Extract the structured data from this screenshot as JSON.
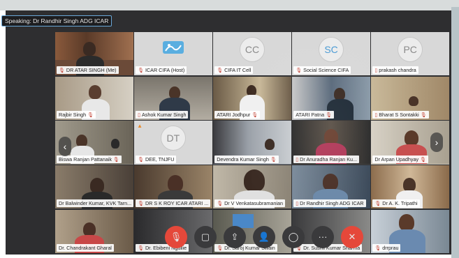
{
  "speaking": {
    "label": "Speaking: Dr Randhir Singh ADG ICAR"
  },
  "tiles": [
    {
      "name": "DR ATAR SINGH (Me)",
      "muted": true
    },
    {
      "name": "ICAR CIFA (Host)",
      "muted": true
    },
    {
      "name": "CIFA IT Cell",
      "muted": true,
      "avatar": "CC"
    },
    {
      "name": "Social Science CIFA",
      "muted": true,
      "avatar": "SC"
    },
    {
      "name": "prakash chandra",
      "muted": false,
      "avatar": "PC"
    },
    {
      "name": "Rajbir Singh",
      "muted": true
    },
    {
      "name": "Ashok Kumar Singh",
      "muted": false
    },
    {
      "name": "ATARI Jodhpur",
      "muted": true
    },
    {
      "name": "ATARI Patna",
      "muted": true
    },
    {
      "name": "Bharat S Sontakki",
      "muted": true
    },
    {
      "name": "Biswa Ranjan Pattanaik",
      "muted": true
    },
    {
      "name": "DEE, TNJFU",
      "muted": true,
      "avatar": "DT"
    },
    {
      "name": "Devendra Kumar Singh",
      "muted": true
    },
    {
      "name": "Dr Anuradha Ranjan Ku...",
      "muted": false
    },
    {
      "name": "Dr Arpan Upadhyay",
      "muted": true
    },
    {
      "name": "Dr Balwinder Kumar, KVK Tarn...",
      "muted": false
    },
    {
      "name": "DR S K ROY ICAR ATARI ...",
      "muted": true
    },
    {
      "name": "Dr V Venkatasubramanian",
      "muted": true
    },
    {
      "name": "Dr Randhir Singh ADG ICAR",
      "muted": false
    },
    {
      "name": "Dr A. K. Tripathi",
      "muted": true
    },
    {
      "name": "Dr. Chandrakant Gharal",
      "muted": false
    },
    {
      "name": "Dr. Ebibeni Ngullie",
      "muted": true
    },
    {
      "name": "Dr. Saroj Kumar Swain",
      "muted": true
    },
    {
      "name": "Dr. Sushil Kumar Sharma",
      "muted": true
    },
    {
      "name": "drrprau",
      "muted": true
    }
  ],
  "icons": {
    "mic_muted": "mic-muted-icon",
    "video_off": "video-off-icon",
    "share": "share-icon",
    "participants": "participants-icon",
    "chat": "chat-icon",
    "more": "more-icon",
    "leave": "leave-icon"
  },
  "toolbar": {
    "mic": "🎙",
    "video": "▢",
    "share": "⇪",
    "participants": "👤",
    "chat": "◯",
    "more": "···",
    "leave": "✕"
  },
  "nav": {
    "prev": "‹",
    "next": "›"
  },
  "colors": {
    "active_border": "#7fc3e8",
    "leave_red": "#e5483a",
    "muted_red": "#c0392b"
  }
}
